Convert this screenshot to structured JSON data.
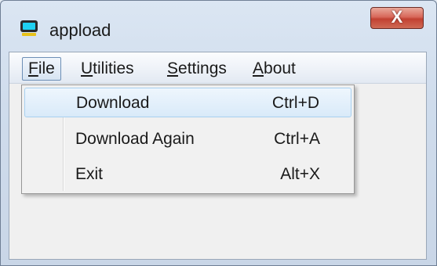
{
  "window": {
    "title": "appload",
    "close_label": "X"
  },
  "menubar": {
    "items": [
      {
        "first": "F",
        "rest": "ile"
      },
      {
        "first": "U",
        "rest": "tilities"
      },
      {
        "first": "S",
        "rest": "ettings"
      },
      {
        "first": "A",
        "rest": "bout"
      }
    ]
  },
  "file_menu": {
    "items": [
      {
        "label": "Download",
        "shortcut": "Ctrl+D"
      },
      {
        "label": "Download Again",
        "shortcut": "Ctrl+A"
      },
      {
        "label": "Exit",
        "shortcut": "Alt+X"
      }
    ]
  },
  "colors": {
    "icon_screen": "#1fd0f0",
    "icon_body": "#2a2a2a",
    "icon_base": "#e8c21a"
  }
}
